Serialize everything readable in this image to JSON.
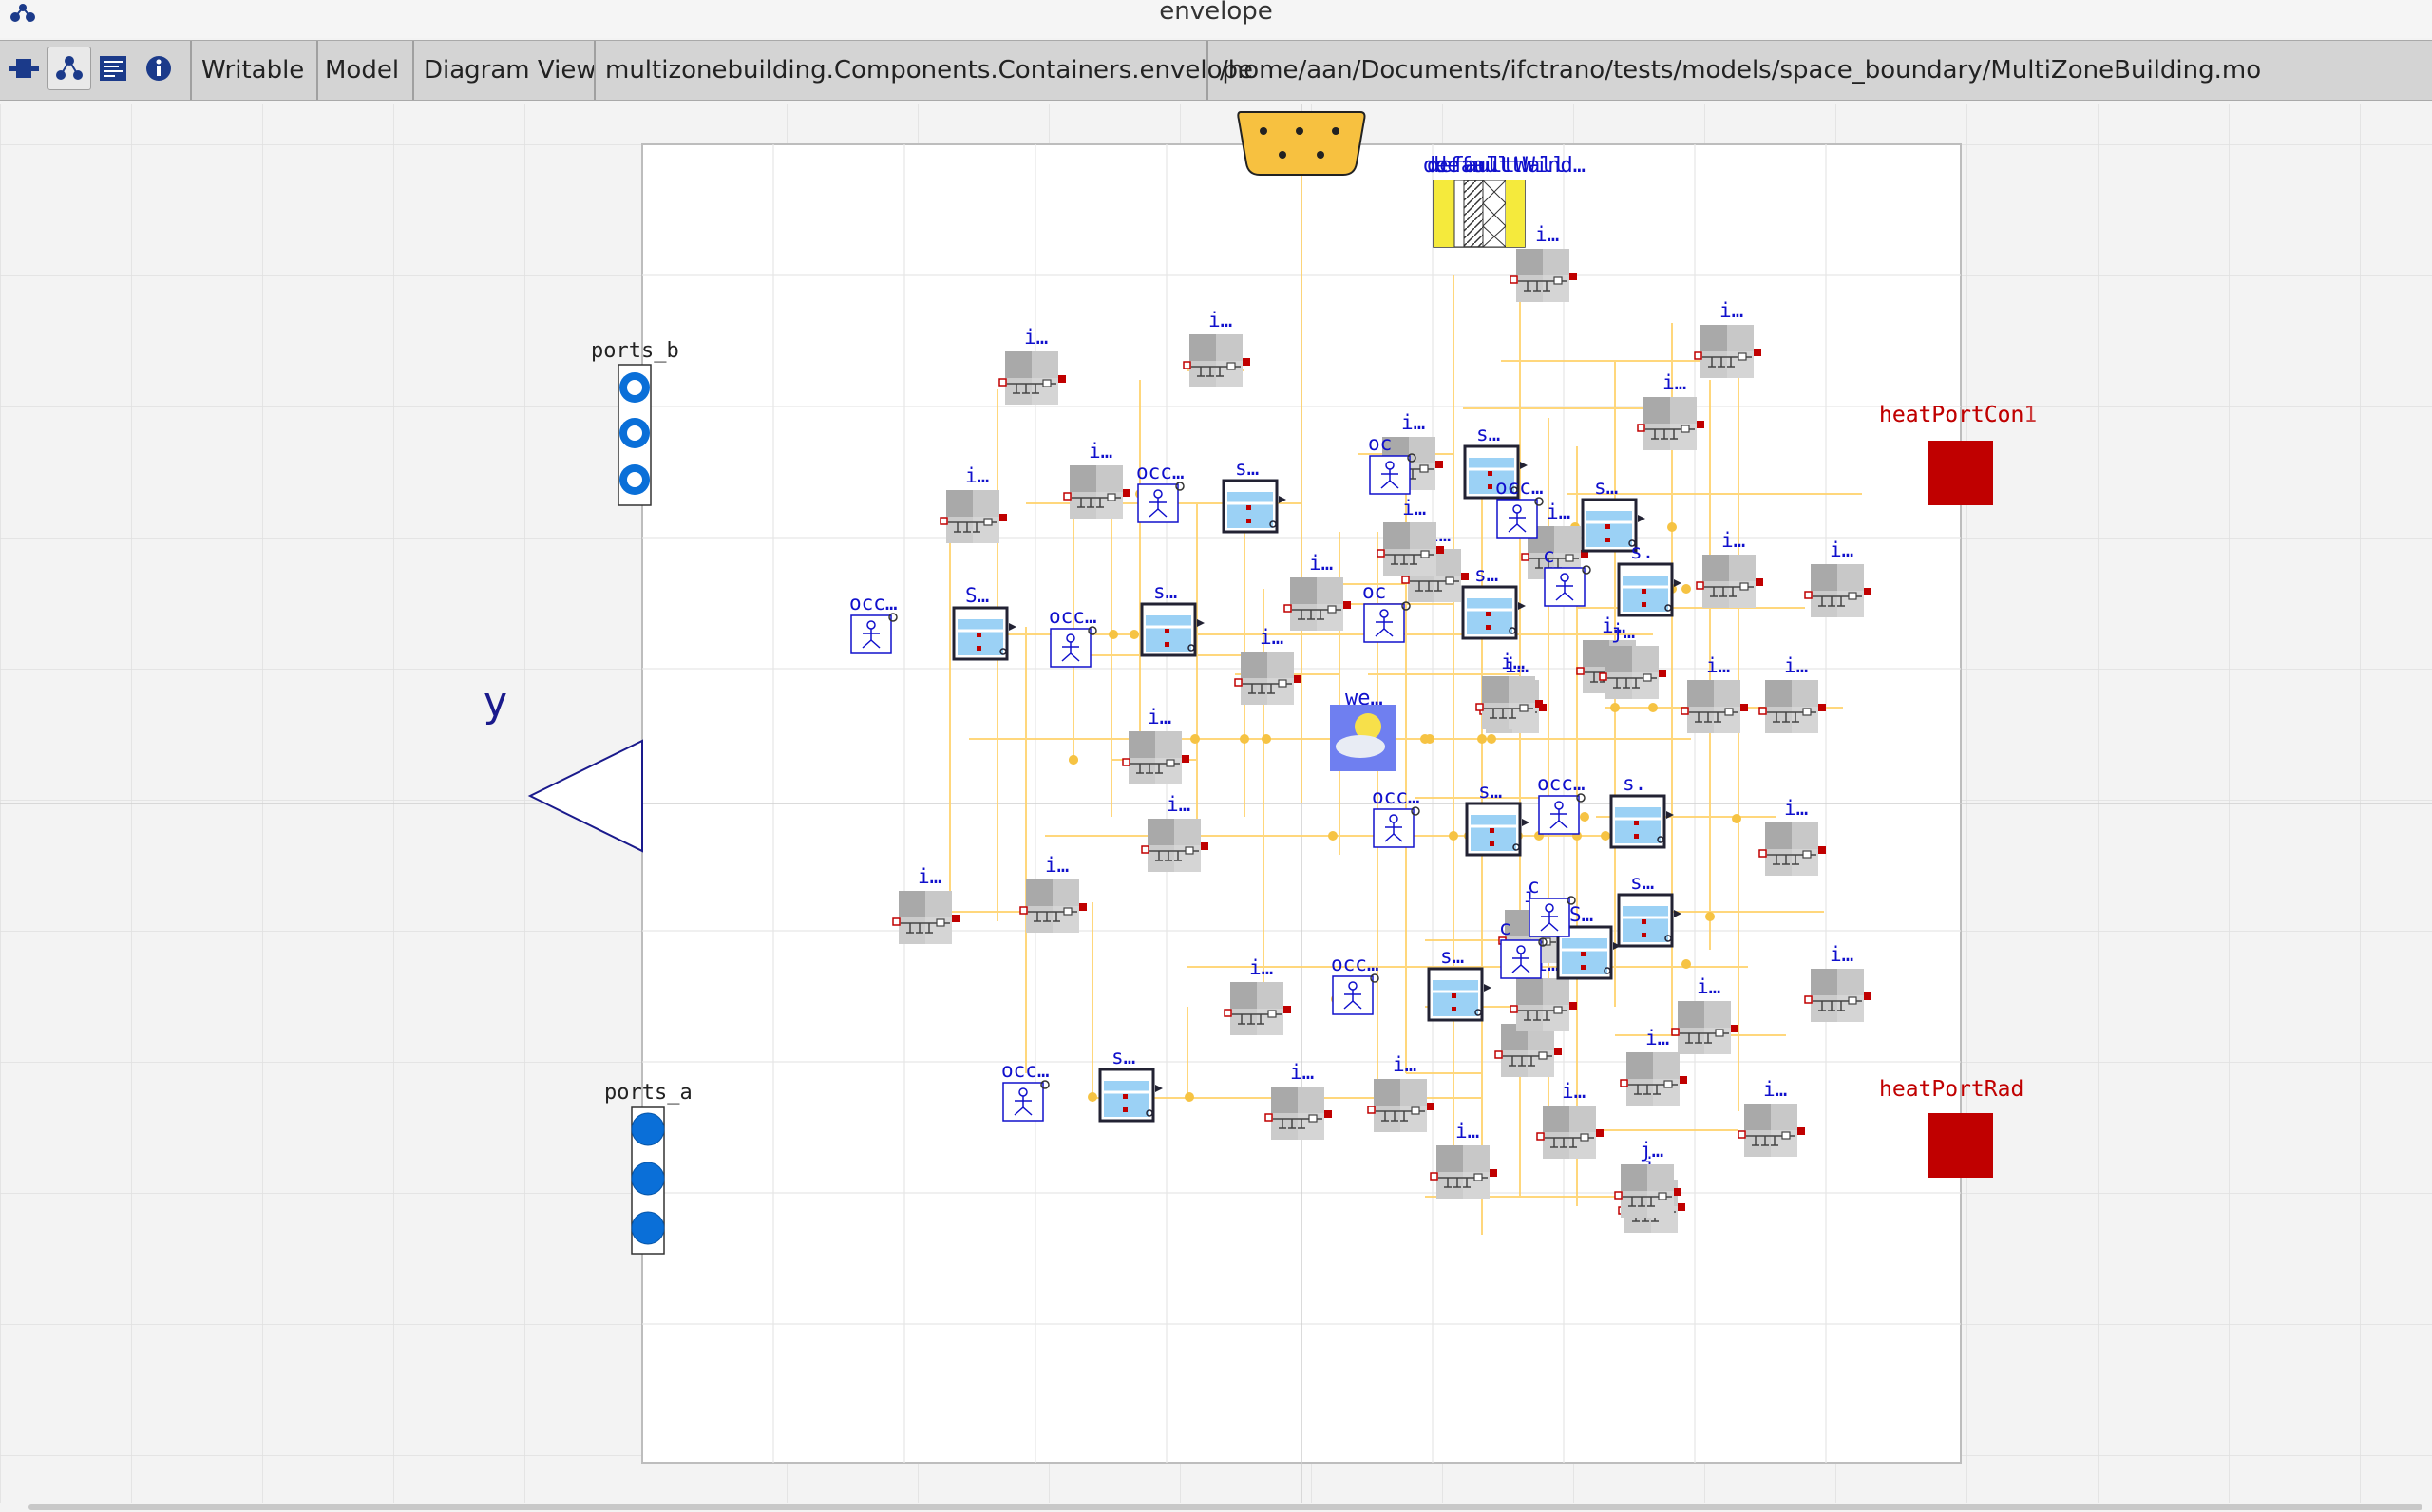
{
  "window": {
    "title": "envelope"
  },
  "toolbar": {
    "icons": [
      "icon-view-icon",
      "diagram-view-icon",
      "text-view-icon",
      "documentation-view-icon"
    ],
    "status_writable": "Writable",
    "status_class": "Model",
    "status_view": "Diagram View",
    "class_path": "multizonebuilding.Components.Containers.envelope",
    "file_path": "/home/aan/Documents/ifctrano/tests/models/space_boundary/MultiZoneBuilding.mo"
  },
  "diagram": {
    "ports_b_label": "ports_b",
    "ports_a_label": "ports_a",
    "y_label": "y",
    "heat_port_con_label": "heatPortCon",
    "heat_port_con_overlap_label": "heatPortCon1",
    "heat_port_rad_label": "heatPortRad",
    "default_label_a": "default",
    "default_label_b": "defaultWall",
    "default_label_c": "defaultWind…",
    "weather_label": "we…",
    "component_labels": {
      "internal": "i…",
      "space": "s…",
      "space_short": "s.",
      "occupancy": "occ…",
      "occupancy_short": "occ",
      "occupancy_o": "oc",
      "occupancy_c": "c",
      "space_alt": "S…",
      "jvariant": "j…"
    },
    "colors": {
      "connector_blue": "#0a6fd8",
      "heat_port_red": "#c00000",
      "label_blue": "#1010cc",
      "label_red": "#c00000",
      "wire": "#ffd36e",
      "node": "#f6c343",
      "bus_fill": "#f7c140",
      "space_fill": "#9bd1f5"
    }
  }
}
